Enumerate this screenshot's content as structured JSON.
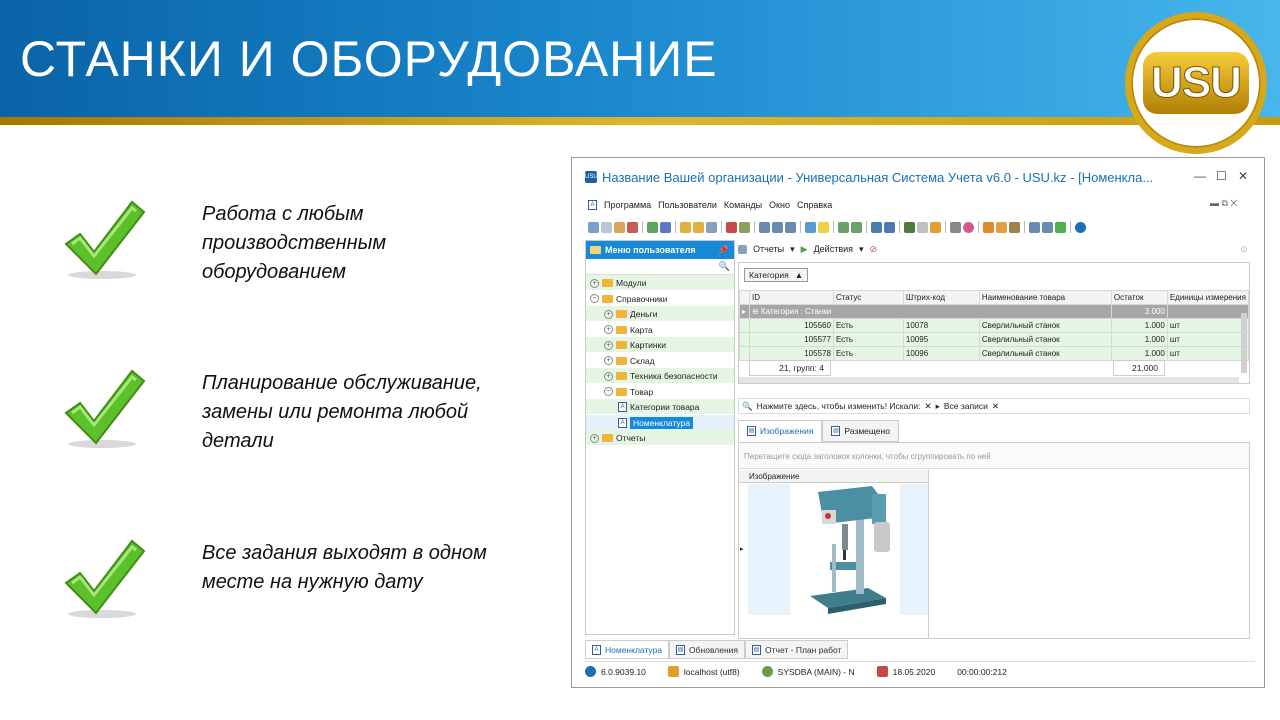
{
  "slide": {
    "title": "СТАНКИ И ОБОРУДОВАНИЕ",
    "logo_text": "USU",
    "bullets": [
      "Работа с любым производственным оборудованием",
      "Планирование обслуживание, замены или ремонта любой детали",
      "Все задания выходят в одном месте на нужную дату"
    ]
  },
  "window": {
    "title": "Название Вашей организации - Универсальная Система Учета v6.0 - USU.kz - [Номенкла...",
    "menu": [
      "Программа",
      "Пользователи",
      "Команды",
      "Окно",
      "Справка"
    ],
    "left_panel": {
      "header": "Меню пользователя",
      "tree": [
        {
          "label": "Модули",
          "level": 0,
          "expander": "+"
        },
        {
          "label": "Справочники",
          "level": 0,
          "expander": "−"
        },
        {
          "label": "Деньги",
          "level": 1,
          "expander": "+"
        },
        {
          "label": "Карта",
          "level": 1,
          "expander": "+"
        },
        {
          "label": "Картинки",
          "level": 1,
          "expander": "+"
        },
        {
          "label": "Склад",
          "level": 1,
          "expander": "+"
        },
        {
          "label": "Техника безопасности",
          "level": 1,
          "expander": "+"
        },
        {
          "label": "Товар",
          "level": 1,
          "expander": "−"
        },
        {
          "label": "Категории товара",
          "level": 2,
          "expander": ""
        },
        {
          "label": "Номенклатура",
          "level": 2,
          "expander": ""
        },
        {
          "label": "Отчеты",
          "level": 0,
          "expander": "+"
        }
      ]
    },
    "right_toolbar": {
      "reports": "Отчеты",
      "actions": "Действия"
    },
    "grid": {
      "group_by": "Категория",
      "columns": [
        "ID",
        "Статус",
        "Штрих-код",
        "Наименование товара",
        "Остаток",
        "Единицы измерения"
      ],
      "group_label": "Категория : Станки",
      "group_total": "3.000",
      "rows": [
        {
          "id": "105560",
          "status": "Есть",
          "barcode": "10078",
          "name": "Сверлильный станок",
          "qty": "1.000",
          "unit": "шт"
        },
        {
          "id": "105577",
          "status": "Есть",
          "barcode": "10095",
          "name": "Сверлильный станок",
          "qty": "1.000",
          "unit": "шт"
        },
        {
          "id": "105578",
          "status": "Есть",
          "barcode": "10096",
          "name": "Сверлильный станок",
          "qty": "1.000",
          "unit": "шт"
        }
      ],
      "footer_count": "21, групп: 4",
      "footer_total": "21.000"
    },
    "filter_bar": {
      "hint": "Нажмите здесь, чтобы изменить! Искали:",
      "all_records": "Все записи"
    },
    "detail_tabs": [
      "Изображения",
      "Размещено"
    ],
    "drop_hint": "Перетащите сюда заголовок колонки, чтобы сгруппировать по ней",
    "image_column": "Изображение",
    "bottom_tabs": [
      "Номенклатура",
      "Обновления",
      "Отчет - План работ"
    ],
    "status": {
      "version": "6.0.9039.10",
      "db": "localhost (utf8)",
      "user": "SYSDBA (MAIN) - N",
      "date": "18.05.2020",
      "timer": "00:00:00:212"
    }
  }
}
